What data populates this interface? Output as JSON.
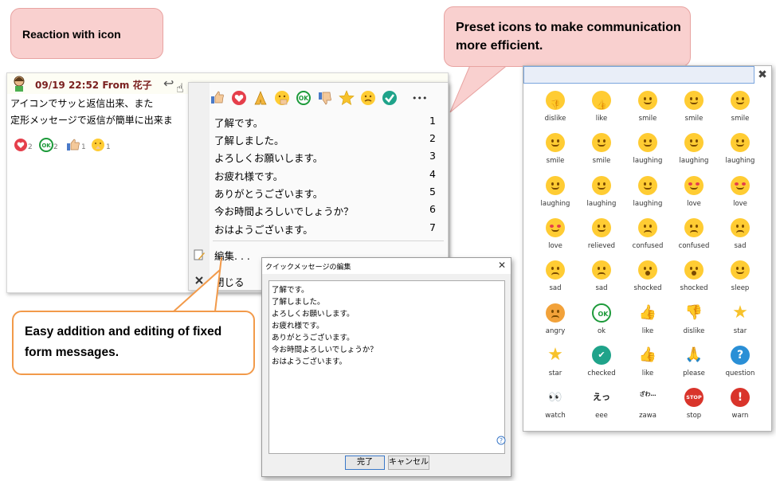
{
  "callouts": {
    "reaction": "Reaction with icon",
    "preset": "Preset icons to make communication more efficient.",
    "easy": "Easy addition and editing of fixed form messages."
  },
  "chat": {
    "header": "09/19 22:52 From 花子",
    "line1": "アイコンでサッと返信出来、また",
    "line2": "定形メッセージで返信が簡単に出来ま",
    "reactions": [
      "2",
      "2",
      "1",
      "1"
    ]
  },
  "menu": {
    "items": [
      {
        "label": "了解です。",
        "num": "1"
      },
      {
        "label": "了解しました。",
        "num": "2"
      },
      {
        "label": "よろしくお願いします。",
        "num": "3"
      },
      {
        "label": "お疲れ様です。",
        "num": "4"
      },
      {
        "label": "ありがとうございます。",
        "num": "5"
      },
      {
        "label": "今お時間よろしいでしょうか？",
        "num": "6"
      },
      {
        "label": "おはようございます。",
        "num": "7"
      }
    ],
    "edit": "編集. . .",
    "close": "閉じる",
    "more": "•••"
  },
  "dialog": {
    "title": "クイックメッセージの編集",
    "lines": [
      "了解です。",
      "了解しました。",
      "よろしくお願いします。",
      "お疲れ様です。",
      "ありがとうございます。",
      "今お時間よろしいでしょうか？",
      "おはようございます。"
    ],
    "ok": "完了",
    "cancel": "キャンセル"
  },
  "panel": {
    "icons": [
      [
        "dislike",
        "like",
        "smile",
        "smile",
        "smile"
      ],
      [
        "smile",
        "smile",
        "laughing",
        "laughing",
        "laughing"
      ],
      [
        "laughing",
        "laughing",
        "laughing",
        "love",
        "love"
      ],
      [
        "love",
        "relieved",
        "confused",
        "confused",
        "sad"
      ],
      [
        "sad",
        "sad",
        "shocked",
        "shocked",
        "sleep"
      ],
      [
        "angry",
        "ok",
        "like",
        "dislike",
        "star"
      ],
      [
        "star",
        "checked",
        "like",
        "please",
        "question"
      ],
      [
        "watch",
        "eee",
        "zawa",
        "stop",
        "warn"
      ]
    ],
    "glyphs": {
      "eee": "えっ",
      "zawa": "ざわ…",
      "stop": "STOP",
      "ok": "OK",
      "question": "?",
      "warn": "!"
    }
  }
}
